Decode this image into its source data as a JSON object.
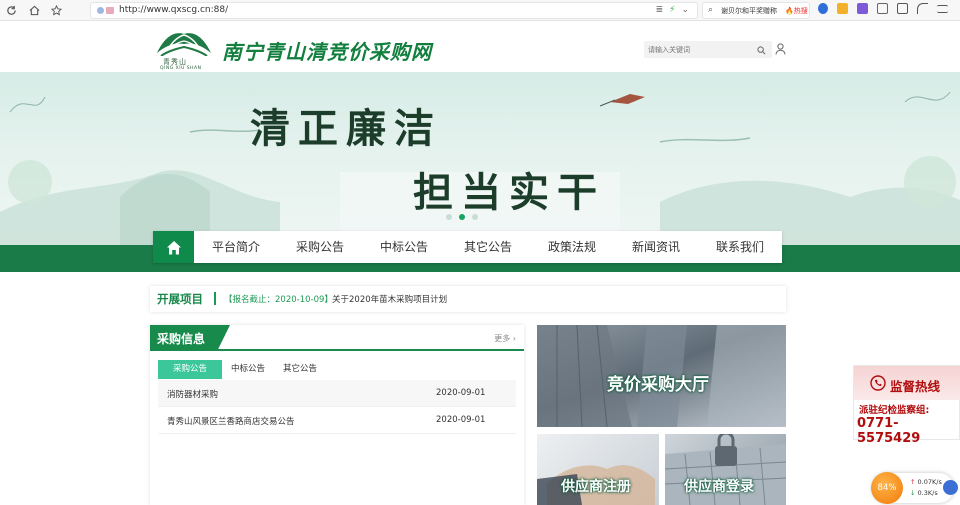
{
  "browser": {
    "url": "http://www.qxscg.cn:88/",
    "search_query": "谢贝尔和平奖赠称",
    "hot_label": "🔥热搜"
  },
  "header": {
    "logo_text": "青秀山",
    "logo_en": "QING XIU SHAN",
    "site_title": "南宁青山清竞价采购网",
    "search_placeholder": "请输入关键词"
  },
  "banner": {
    "slogan_line1": "清正廉洁",
    "slogan_line2": "担当实干"
  },
  "nav": {
    "items": [
      "平台简介",
      "采购公告",
      "中标公告",
      "其它公告",
      "政策法规",
      "新闻资讯",
      "联系我们"
    ]
  },
  "ticker": {
    "title": "开展项目",
    "tag": "【报名截止：2020-10-09】",
    "text": "关于2020年苗木采购项目计划"
  },
  "procurement": {
    "title": "采购信息",
    "more": "更多",
    "tabs": [
      "采购公告",
      "中标公告",
      "其它公告"
    ],
    "rows": [
      {
        "title": "消防器材采购",
        "date": "2020-09-01"
      },
      {
        "title": "青秀山风景区兰香路商店交易公告",
        "date": "2020-09-01"
      }
    ]
  },
  "tiles": {
    "main": "竞价采购大厅",
    "register": "供应商注册",
    "login": "供应商登录"
  },
  "hotline": {
    "title": "监督热线",
    "subtitle": "派驻纪检监察组:",
    "number": "0771-5575429"
  },
  "speed": {
    "percent": "84%",
    "up": "0.07K/s",
    "down": "0.3K/s"
  },
  "colors": {
    "brand_green": "#137f3f",
    "accent_teal": "#3cc79a",
    "hotline_red": "#b10d0d"
  }
}
